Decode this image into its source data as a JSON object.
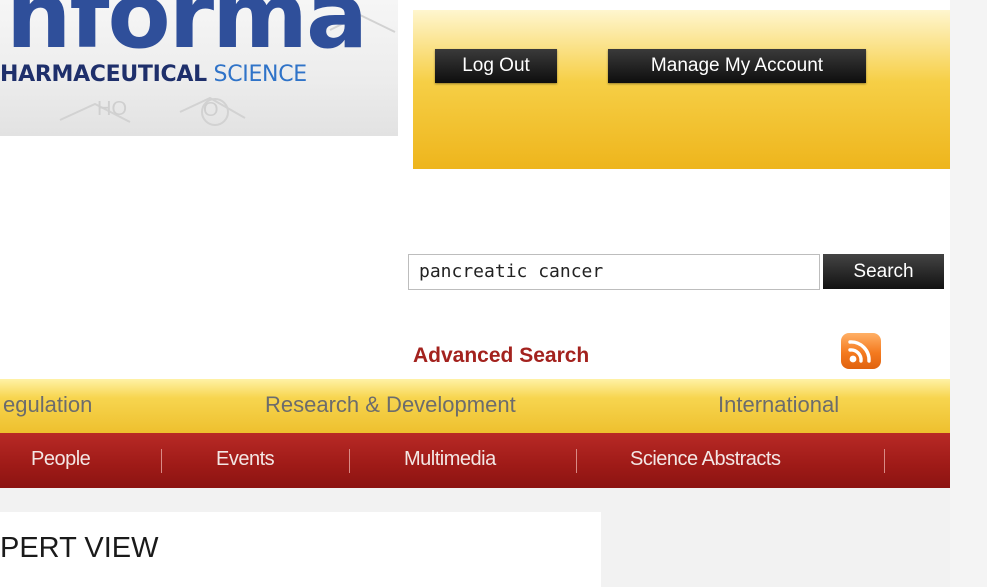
{
  "logo": {
    "wordmark": "nforma",
    "tagline_bold": "HARMACEUTICAL",
    "tagline_light": "SCIENCE",
    "deco_text_ho": "HO",
    "deco_text_o": "O"
  },
  "account": {
    "logout_label": "Log Out",
    "manage_label": "Manage My Account"
  },
  "search": {
    "value": "pancreatic cancer",
    "button_label": "Search",
    "advanced_label": "Advanced Search"
  },
  "rss": {
    "icon": "rss-icon"
  },
  "nav_primary": [
    {
      "label": "egulation"
    },
    {
      "label": "Research & Development"
    },
    {
      "label": "International"
    }
  ],
  "nav_secondary": [
    {
      "label": "People"
    },
    {
      "label": "Events"
    },
    {
      "label": "Multimedia"
    },
    {
      "label": "Science Abstracts"
    }
  ],
  "content": {
    "heading": "PERT VIEW"
  },
  "colors": {
    "brand_blue": "#2f4f9a",
    "accent_gold": "#eec02e",
    "nav_red": "#9e1a17",
    "link_red": "#a3221e"
  }
}
